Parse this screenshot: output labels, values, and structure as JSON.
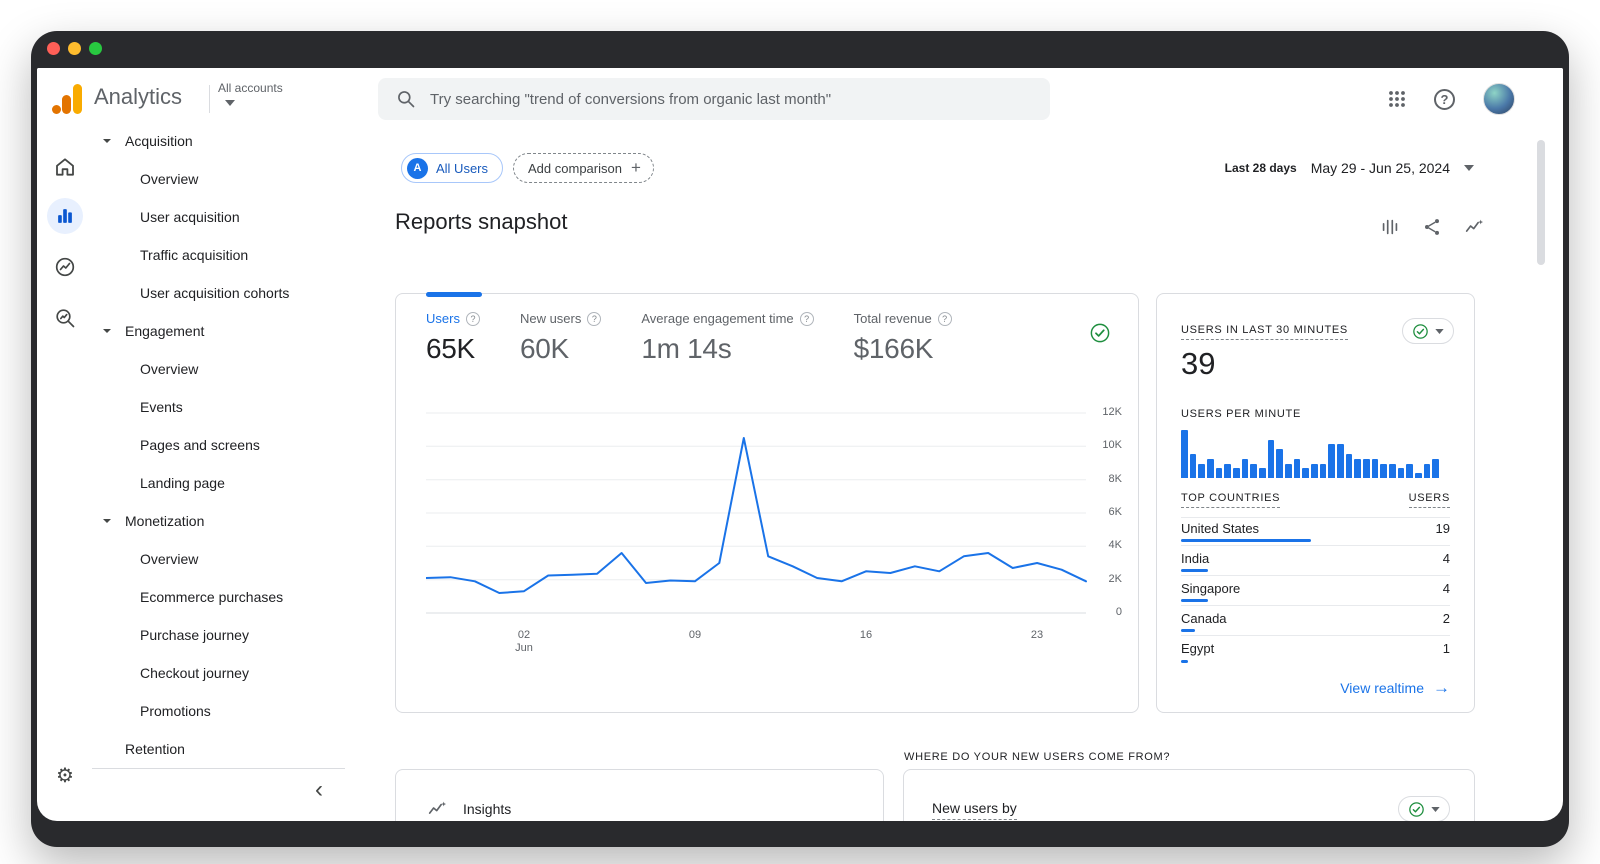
{
  "window": {
    "traffic_lights": [
      {
        "name": "close",
        "color": "#ff5f57"
      },
      {
        "name": "minimize",
        "color": "#febc2e"
      },
      {
        "name": "zoom",
        "color": "#28c840"
      }
    ]
  },
  "header": {
    "app_name": "Analytics",
    "account_switcher": "All accounts",
    "search": {
      "placeholder": "Try searching \"trend of conversions from organic last month\""
    }
  },
  "sidebar": {
    "sections": [
      {
        "label": "Acquisition",
        "expanded": true,
        "items": [
          "Overview",
          "User acquisition",
          "Traffic acquisition",
          "User acquisition cohorts"
        ]
      },
      {
        "label": "Engagement",
        "expanded": true,
        "items": [
          "Overview",
          "Events",
          "Pages and screens",
          "Landing page"
        ]
      },
      {
        "label": "Monetization",
        "expanded": true,
        "items": [
          "Overview",
          "Ecommerce purchases",
          "Purchase journey",
          "Checkout journey",
          "Promotions"
        ]
      },
      {
        "label": "Retention",
        "expanded": false,
        "items": []
      }
    ]
  },
  "toolbar": {
    "segment_avatar": "A",
    "segment_chip": "All Users",
    "add_comparison": "Add comparison",
    "date_preset": "Last 28 days",
    "date_range": "May 29 - Jun 25, 2024"
  },
  "report": {
    "title": "Reports snapshot",
    "metrics": [
      {
        "label": "Users",
        "value": "65K",
        "active": true
      },
      {
        "label": "New users",
        "value": "60K",
        "active": false
      },
      {
        "label": "Average engagement time",
        "value": "1m 14s",
        "active": false
      },
      {
        "label": "Total revenue",
        "value": "$166K",
        "active": false
      }
    ]
  },
  "chart_data": [
    {
      "id": "users-over-time",
      "type": "line",
      "title": "Users",
      "x": [
        "May 29",
        "May 30",
        "May 31",
        "Jun 1",
        "Jun 2",
        "Jun 3",
        "Jun 4",
        "Jun 5",
        "Jun 6",
        "Jun 7",
        "Jun 8",
        "Jun 9",
        "Jun 10",
        "Jun 11",
        "Jun 12",
        "Jun 13",
        "Jun 14",
        "Jun 15",
        "Jun 16",
        "Jun 17",
        "Jun 18",
        "Jun 19",
        "Jun 20",
        "Jun 21",
        "Jun 22",
        "Jun 23",
        "Jun 24",
        "Jun 25"
      ],
      "series": [
        {
          "name": "Users",
          "values": [
            2100,
            2150,
            1900,
            1200,
            1300,
            2250,
            2300,
            2350,
            3600,
            1800,
            1950,
            1900,
            3000,
            10500,
            3400,
            2800,
            2100,
            1900,
            2500,
            2400,
            2800,
            2500,
            3400,
            3600,
            2700,
            3000,
            2600,
            1900
          ]
        }
      ],
      "ylim": [
        0,
        12000
      ],
      "yticks": [
        "12K",
        "10K",
        "8K",
        "6K",
        "4K",
        "2K",
        "0"
      ],
      "xticks": [
        {
          "i": 4,
          "label": "02",
          "sub": "Jun"
        },
        {
          "i": 11,
          "label": "09",
          "sub": ""
        },
        {
          "i": 18,
          "label": "16",
          "sub": ""
        },
        {
          "i": 25,
          "label": "23",
          "sub": ""
        }
      ],
      "grid": true,
      "legend": "none",
      "line_color": "#1a73e8"
    },
    {
      "id": "users-per-minute",
      "type": "bar",
      "title": "USERS PER MINUTE",
      "values": [
        10,
        5,
        3,
        4,
        2,
        3,
        2,
        4,
        3,
        2,
        8,
        6,
        3,
        4,
        2,
        3,
        3,
        7,
        7,
        5,
        4,
        4,
        4,
        3,
        3,
        2,
        3,
        1,
        3,
        4
      ],
      "bar_color": "#1a73e8"
    }
  ],
  "realtime": {
    "title": "USERS IN LAST 30 MINUTES",
    "users_count": "39",
    "per_minute_label": "USERS PER MINUTE",
    "table": {
      "col1": "TOP COUNTRIES",
      "col2": "USERS",
      "rows": [
        {
          "country": "United States",
          "users": 19
        },
        {
          "country": "India",
          "users": 4
        },
        {
          "country": "Singapore",
          "users": 4
        },
        {
          "country": "Canada",
          "users": 2
        },
        {
          "country": "Egypt",
          "users": 1
        }
      ]
    },
    "link": "View realtime"
  },
  "bottom": {
    "insights_title": "Insights",
    "section_question": "WHERE DO YOUR NEW USERS COME FROM?",
    "new_users_card_title": "New users by"
  },
  "icons": {
    "help_glyph": "?",
    "plus_glyph": "+",
    "arrow_right_glyph": "→",
    "settings_glyph": "⚙",
    "collapse_glyph": "‹"
  },
  "colors": {
    "accent": "#1a73e8",
    "success": "#1e8e3e",
    "text": "#202124",
    "muted": "#5f6368",
    "border": "#dadce0",
    "logo_amber": "#f9ab00",
    "logo_orange": "#e37400"
  }
}
